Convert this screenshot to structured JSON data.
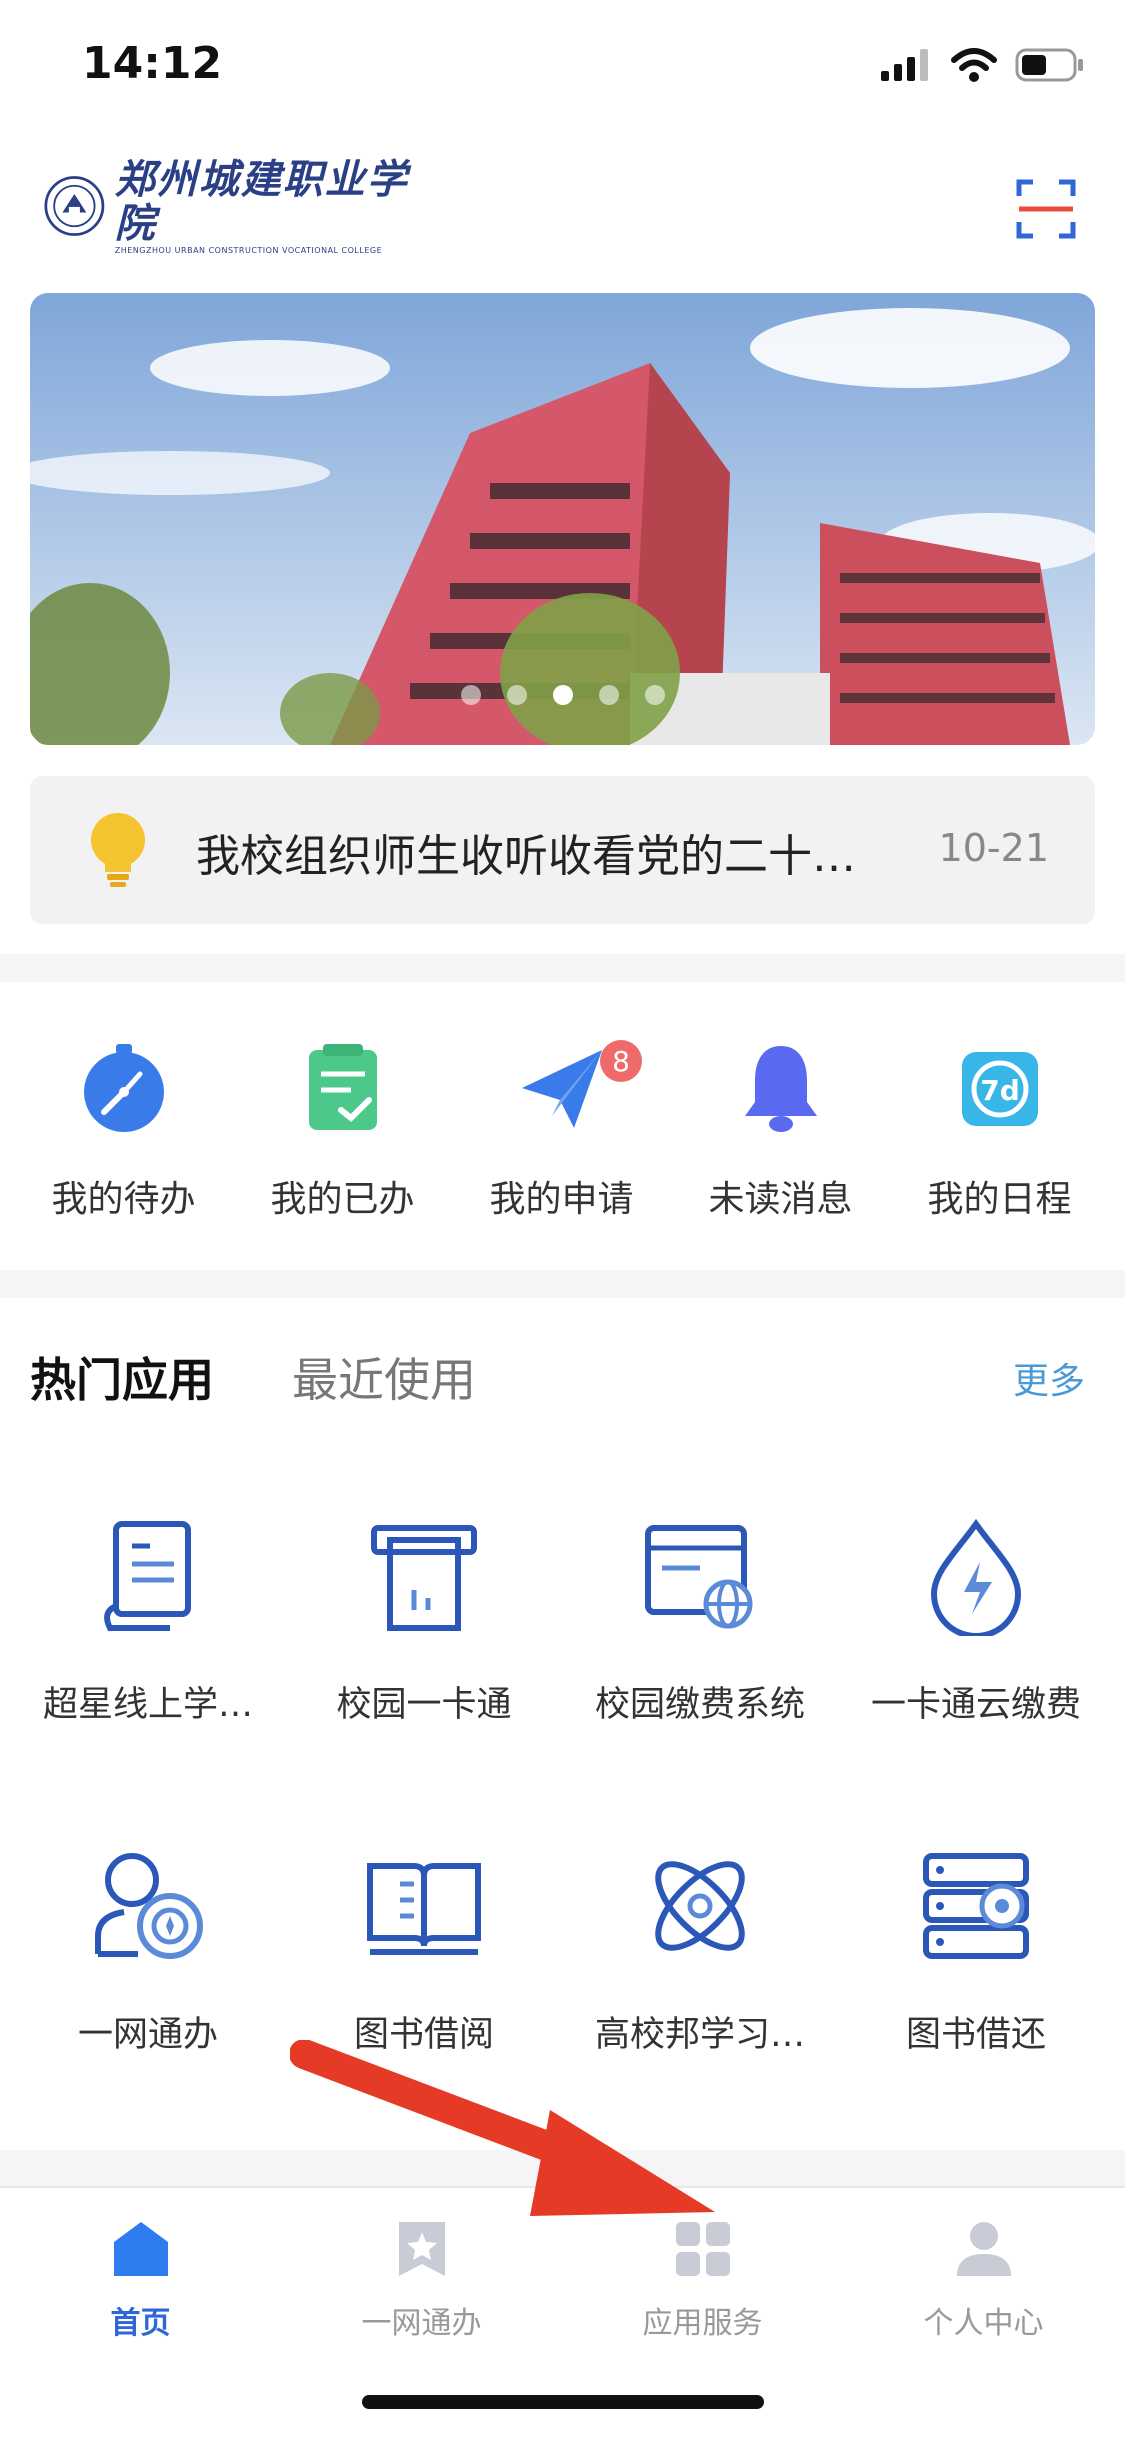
{
  "status_bar": {
    "time": "14:12"
  },
  "header": {
    "logo_cn": "郑州城建职业学院",
    "logo_en": "ZHENGZHOU URBAN CONSTRUCTION VOCATIONAL COLLEGE",
    "scan_icon": "scan-icon"
  },
  "banner": {
    "slides": 5,
    "active_slide": 3
  },
  "notice": {
    "icon": "lightbulb-icon",
    "text": "我校组织师生收听收看党的二十…",
    "date": "10-21"
  },
  "quick_links": [
    {
      "label": "我的待办",
      "icon": "stopwatch-icon"
    },
    {
      "label": "我的已办",
      "icon": "checklist-icon"
    },
    {
      "label": "我的申请",
      "icon": "paper-plane-icon",
      "badge": "8"
    },
    {
      "label": "未读消息",
      "icon": "bell-icon"
    },
    {
      "label": "我的日程",
      "icon": "calendar-7d-icon"
    }
  ],
  "apps_section": {
    "tab_hot": "热门应用",
    "tab_recent": "最近使用",
    "more": "更多"
  },
  "apps": [
    {
      "label": "超星线上学…",
      "icon": "book-scroll-icon"
    },
    {
      "label": "校园一卡通",
      "icon": "card-reader-icon"
    },
    {
      "label": "校园缴费系统",
      "icon": "web-payment-icon"
    },
    {
      "label": "一卡通云缴费",
      "icon": "drop-bolt-icon"
    },
    {
      "label": "一网通办",
      "icon": "user-service-icon"
    },
    {
      "label": "图书借阅",
      "icon": "open-book-icon"
    },
    {
      "label": "高校邦学习…",
      "icon": "atom-icon"
    },
    {
      "label": "图书借还",
      "icon": "server-gear-icon"
    }
  ],
  "bottom_nav": [
    {
      "label": "首页",
      "icon": "home-icon",
      "active": true
    },
    {
      "label": "一网通办",
      "icon": "bookmark-star-icon"
    },
    {
      "label": "应用服务",
      "icon": "grid-icon"
    },
    {
      "label": "个人中心",
      "icon": "person-icon"
    }
  ],
  "colors": {
    "primary": "#2f66d8",
    "icon_blue": "#2b58b8",
    "badge": "#ef6a6a",
    "more_link": "#4a9ad8",
    "arrow": "#e53a26"
  }
}
